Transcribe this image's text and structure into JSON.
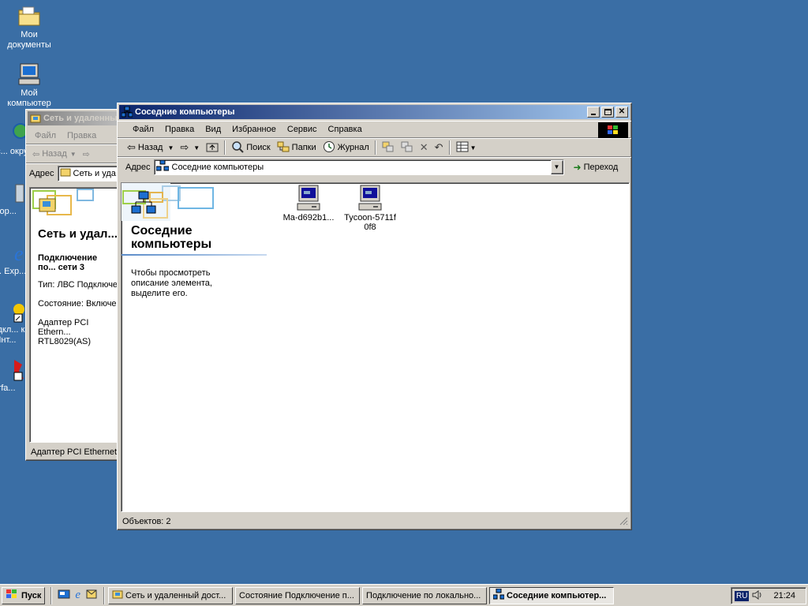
{
  "desktop": {
    "icons": [
      {
        "label": "Мои документы",
        "icon": "folder-documents-icon"
      },
      {
        "label": "Мой компьютер",
        "icon": "my-computer-icon"
      },
      {
        "label": "Мое с... окру...",
        "icon": "network-places-icon"
      },
      {
        "label": "Кор...",
        "icon": "recycle-bin-icon"
      },
      {
        "label": "Int... Exp...",
        "icon": "internet-explorer-icon"
      },
      {
        "label": "Подкл... к Инт...",
        "icon": "connect-internet-icon"
      },
      {
        "label": "Irfa...",
        "icon": "irfanview-icon"
      }
    ],
    "color": "#3a6ea5"
  },
  "back_window": {
    "title": "Сеть и удаленны...",
    "menu": [
      "Файл",
      "Правка"
    ],
    "toolbar": {
      "back_label": "Назад"
    },
    "address_label": "Адрес",
    "address_value": "Сеть и уда...",
    "panel_title": "Сеть и удал... доступ к се...",
    "connection_title": "Подключение по... сети 3",
    "type": "Тип: ЛВС Подключе...",
    "state": "Состояние: Включе...",
    "adapter": "Адаптер PCI Ethern... RTL8029(AS)",
    "status": "Адаптер PCI Ethernet"
  },
  "main_window": {
    "title": "Соседние компьютеры",
    "menu": [
      "Файл",
      "Правка",
      "Вид",
      "Избранное",
      "Сервис",
      "Справка"
    ],
    "toolbar": {
      "back": "Назад",
      "search": "Поиск",
      "folders": "Папки",
      "history": "Журнал"
    },
    "address": {
      "label": "Адрес",
      "value": "Соседние компьютеры",
      "go": "Переход"
    },
    "panel": {
      "title": "Соседние компьютеры",
      "hint": "Чтобы просмотреть описание элемента, выделите его."
    },
    "items": [
      {
        "label": "Ma-d692b1...",
        "icon": "computer-icon"
      },
      {
        "label": "Tycoon-5711f 0f8",
        "icon": "computer-icon"
      }
    ],
    "status": "Объектов: 2",
    "accent": "#0a246a"
  },
  "taskbar": {
    "start": "Пуск",
    "tasks": [
      {
        "label": "Сеть и удаленный дост...",
        "active": false
      },
      {
        "label": "Состояние Подключение п...",
        "active": false
      },
      {
        "label": "Подключение по локально...",
        "active": false
      },
      {
        "label": "Соседние компьютер...",
        "active": true
      }
    ],
    "lang": "RU",
    "clock": "21:24"
  }
}
